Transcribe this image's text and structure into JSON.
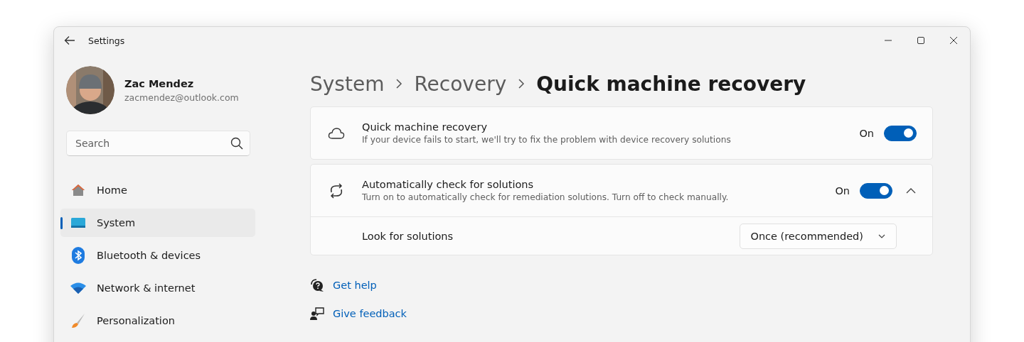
{
  "window": {
    "title": "Settings"
  },
  "user": {
    "name": "Zac Mendez",
    "email": "zacmendez@outlook.com"
  },
  "search": {
    "placeholder": "Search"
  },
  "nav": [
    {
      "label": "Home",
      "kind": "home",
      "selected": false
    },
    {
      "label": "System",
      "kind": "system",
      "selected": true
    },
    {
      "label": "Bluetooth & devices",
      "kind": "bluetooth",
      "selected": false
    },
    {
      "label": "Network & internet",
      "kind": "network",
      "selected": false
    },
    {
      "label": "Personalization",
      "kind": "personalization",
      "selected": false
    }
  ],
  "breadcrumb": [
    "System",
    "Recovery",
    "Quick machine recovery"
  ],
  "settings": [
    {
      "kind": "cloud",
      "title": "Quick machine recovery",
      "description": "If your device fails to start, we'll try to fix the problem with device recovery solutions",
      "state_label": "On",
      "on": true
    },
    {
      "kind": "sync",
      "title": "Automatically check for solutions",
      "description": "Turn on to automatically check for remediation solutions. Turn off to check manually.",
      "state_label": "On",
      "on": true,
      "expanded": true,
      "children": [
        {
          "label": "Look for solutions",
          "value": "Once (recommended)"
        }
      ]
    }
  ],
  "links": [
    {
      "kind": "help",
      "label": "Get help"
    },
    {
      "kind": "feedback",
      "label": "Give feedback"
    }
  ]
}
